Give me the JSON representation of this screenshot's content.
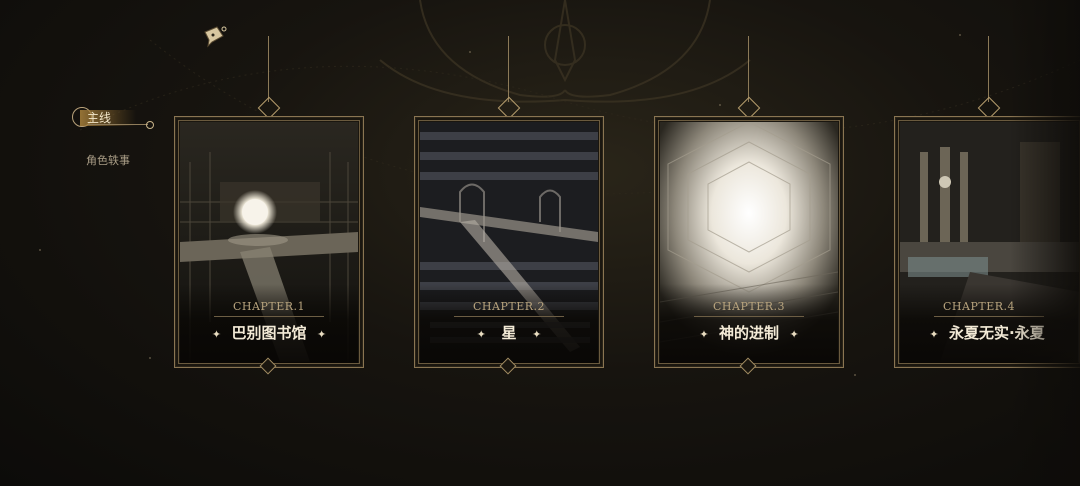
{
  "sidebar": {
    "tabs": [
      {
        "label": "主线",
        "active": true
      },
      {
        "label": "角色轶事",
        "active": false
      }
    ]
  },
  "top_icon": "chat-bubble-icon",
  "chapters": [
    {
      "chapter": "CHAPTER.1",
      "title": "巴别图书馆",
      "art": "library-hall-with-glowing-orb"
    },
    {
      "chapter": "CHAPTER.2",
      "title": "星",
      "art": "stacked-library-shelves"
    },
    {
      "chapter": "CHAPTER.3",
      "title": "神的进制",
      "art": "bright-hexagonal-shaft"
    },
    {
      "chapter": "CHAPTER.4",
      "title": "永夏无实·永夏",
      "art": "hall-with-pools"
    }
  ],
  "colors": {
    "gold": "#b59c6c",
    "text_light": "#f3ead6",
    "background": "#15120d"
  }
}
